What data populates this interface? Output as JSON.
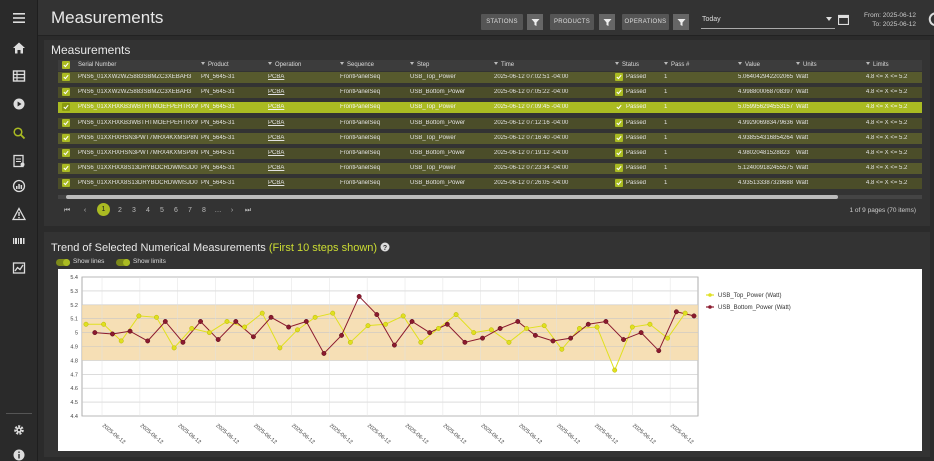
{
  "header": {
    "title": "Measurements",
    "filters": [
      {
        "label": "STATIONS"
      },
      {
        "label": "PRODUCTS"
      },
      {
        "label": "OPERATIONS"
      }
    ],
    "date_select": "Today",
    "range_from": "From: 2025-06-12",
    "range_to": "To: 2025-06-12"
  },
  "table_panel": {
    "title": "Measurements",
    "columns": [
      "Serial Number",
      "Product",
      "Operation",
      "Sequence",
      "Step",
      "Time",
      "Status",
      "Pass #",
      "Value",
      "Units",
      "Limits"
    ],
    "rows": [
      {
        "sn": "PNS6_01XXW2WZ5883SBMZC3XEBAH3",
        "product": "PN_5645-31",
        "op": "PCBA",
        "seq": "FrontPanelSeq",
        "step": "USB_Top_Power",
        "time": "2025-06-12 07:02:51 -04:00",
        "status": "Passed",
        "pass": "1",
        "value": "5.064042942202065",
        "units": "Watt",
        "limits": "4.8 <= X <= 5.2",
        "selected": false
      },
      {
        "sn": "PNS6_01XXW2WZ5883SBMZC3XEBAH3",
        "product": "PN_5645-31",
        "op": "PCBA",
        "seq": "FrontPanelSeq",
        "step": "USB_Bottom_Power",
        "time": "2025-06-12 07:05:22 -04:00",
        "status": "Passed",
        "pass": "1",
        "value": "4.998800068708397",
        "units": "Watt",
        "limits": "4.8 <= X <= 5.2",
        "selected": false
      },
      {
        "sn": "PNS6_01XXHXKB3WBTHTMOEFPEHTRXWB",
        "product": "PN_5645-31",
        "op": "PCBA",
        "seq": "FrontPanelSeq",
        "step": "USB_Top_Power",
        "time": "2025-06-12 07:09:45 -04:00",
        "status": "Passed",
        "pass": "1",
        "value": "5.059956294553157",
        "units": "Watt",
        "limits": "4.8 <= X <= 5.2",
        "selected": true
      },
      {
        "sn": "PNS6_01XXHXKB3WBTHTMOEFPEHTRXWB",
        "product": "PN_5645-31",
        "op": "PCBA",
        "seq": "FrontPanelSeq",
        "step": "USB_Bottom_Power",
        "time": "2025-06-12 07:12:16 -04:00",
        "status": "Passed",
        "pass": "1",
        "value": "4.992906983479636",
        "units": "Watt",
        "limits": "4.8 <= X <= 5.2",
        "selected": false
      },
      {
        "sn": "PNS6_01XXHXHSN3PWT7MRX4KXMSP8N7",
        "product": "PN_5645-31",
        "op": "PCBA",
        "seq": "FrontPanelSeq",
        "step": "USB_Top_Power",
        "time": "2025-06-12 07:16:40 -04:00",
        "status": "Passed",
        "pass": "1",
        "value": "4.938554316854264",
        "units": "Watt",
        "limits": "4.8 <= X <= 5.2",
        "selected": false
      },
      {
        "sn": "PNS6_01XXHXHSN3PWT7MRX4KXMSP8N7",
        "product": "PN_5645-31",
        "op": "PCBA",
        "seq": "FrontPanelSeq",
        "step": "USB_Bottom_Power",
        "time": "2025-06-12 07:19:12 -04:00",
        "status": "Passed",
        "pass": "1",
        "value": "4.98020481528823",
        "units": "Watt",
        "limits": "4.8 <= X <= 5.2",
        "selected": false
      },
      {
        "sn": "PNS6_01XXHXX8S13DRYBOCRDWMSJD0W",
        "product": "PN_5645-31",
        "op": "PCBA",
        "seq": "FrontPanelSeq",
        "step": "USB_Top_Power",
        "time": "2025-06-12 07:23:34 -04:00",
        "status": "Passed",
        "pass": "1",
        "value": "5.124009182455575",
        "units": "Watt",
        "limits": "4.8 <= X <= 5.2",
        "selected": false
      },
      {
        "sn": "PNS6_01XXHXX8S13DRYBOCRDWMSJD0W",
        "product": "PN_5645-31",
        "op": "PCBA",
        "seq": "FrontPanelSeq",
        "step": "USB_Bottom_Power",
        "time": "2025-06-12 07:26:05 -04:00",
        "status": "Passed",
        "pass": "1",
        "value": "4.935133387328688",
        "units": "Watt",
        "limits": "4.8 <= X <= 5.2",
        "selected": false
      }
    ],
    "pager": {
      "first": "⏮",
      "prev": "‹",
      "pages": [
        "1",
        "2",
        "3",
        "4",
        "5",
        "6",
        "7",
        "8",
        "…"
      ],
      "next": "›",
      "last": "⏭",
      "current": "1",
      "info": "1 of 9 pages (70 items)"
    }
  },
  "chart_panel": {
    "title": "Trend of Selected Numerical Measurements",
    "title_highlight": "(First 10 steps shown)",
    "toggle_lines": "Show lines",
    "toggle_limits": "Show limits",
    "colors": {
      "top": "#e0e020",
      "bottom": "#8b1a2e",
      "limit_band": "#f5d9a8",
      "accent": "#aabb22"
    }
  },
  "chart_data": {
    "type": "line",
    "ylim": [
      4.4,
      5.4
    ],
    "yticks": [
      "4.4",
      "4.5",
      "4.6",
      "4.7",
      "4.8",
      "4.9",
      "5",
      "5.1",
      "5.2",
      "5.3",
      "5.4"
    ],
    "limits": [
      4.8,
      5.2
    ],
    "xtick_labels": [
      "2025-06-12",
      "2025-06-12",
      "2025-06-12",
      "2025-06-12",
      "2025-06-12",
      "2025-06-12",
      "2025-06-12",
      "2025-06-12",
      "2025-06-12",
      "2025-06-12",
      "2025-06-12",
      "2025-06-12",
      "2025-06-12",
      "2025-06-12",
      "2025-06-12",
      "2025-06-12"
    ],
    "series": [
      {
        "name": "USB_Top_Power (Watt)",
        "color": "#e0e020",
        "x": [
          0,
          2,
          4,
          6,
          8,
          10,
          12,
          14,
          16,
          18,
          20,
          22,
          24,
          26,
          28,
          30,
          32,
          34,
          36,
          38,
          40,
          42,
          44,
          46,
          48,
          50,
          52,
          54,
          56,
          58,
          60,
          62,
          64,
          66,
          68
        ],
        "values": [
          5.06,
          5.06,
          4.94,
          5.12,
          5.11,
          4.89,
          5.03,
          5.0,
          5.08,
          5.04,
          5.14,
          4.89,
          5.02,
          5.11,
          5.14,
          4.93,
          5.05,
          5.06,
          5.12,
          4.93,
          5.03,
          5.13,
          5.0,
          5.02,
          4.93,
          5.03,
          5.05,
          4.88,
          5.03,
          5.04,
          4.73,
          5.04,
          5.06,
          4.96,
          5.14
        ]
      },
      {
        "name": "USB_Bottom_Power (Watt)",
        "color": "#8b1a2e",
        "x": [
          1,
          3,
          5,
          7,
          9,
          11,
          13,
          15,
          17,
          19,
          21,
          23,
          25,
          27,
          29,
          31,
          33,
          35,
          37,
          39,
          41,
          43,
          45,
          47,
          49,
          51,
          53,
          55,
          57,
          59,
          61,
          63,
          65,
          67,
          69
        ],
        "values": [
          5.0,
          4.99,
          5.01,
          4.94,
          5.08,
          4.93,
          5.08,
          4.95,
          5.08,
          4.97,
          5.11,
          5.04,
          5.08,
          4.85,
          4.98,
          5.26,
          5.13,
          4.91,
          5.08,
          5.0,
          5.06,
          4.93,
          4.96,
          5.03,
          5.08,
          4.98,
          4.94,
          4.96,
          5.06,
          5.08,
          4.95,
          5.0,
          4.87,
          5.15,
          5.12
        ]
      }
    ]
  }
}
